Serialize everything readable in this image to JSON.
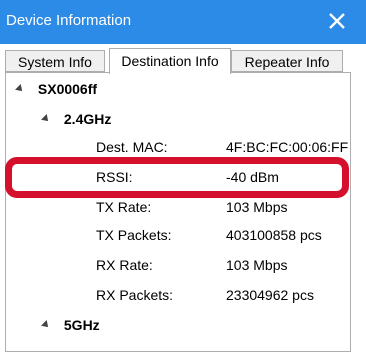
{
  "window": {
    "title": "Device Information",
    "close_label": "close"
  },
  "tabs": [
    {
      "label": "System Info"
    },
    {
      "label": "Destination Info"
    },
    {
      "label": "Repeater Info"
    }
  ],
  "tree": {
    "root": {
      "label": "SX0006ff"
    },
    "band1": {
      "label": "2.4GHz"
    },
    "band2": {
      "label": "5GHz"
    },
    "props": [
      {
        "name": "Dest. MAC:",
        "value": "4F:BC:FC:00:06:FF"
      },
      {
        "name": "RSSI:",
        "value": "-40 dBm"
      },
      {
        "name": "TX Rate:",
        "value": "103 Mbps"
      },
      {
        "name": "TX Packets:",
        "value": "403100858 pcs"
      },
      {
        "name": "RX Rate:",
        "value": "103 Mbps"
      },
      {
        "name": "RX Packets:",
        "value": "23304962 pcs"
      }
    ]
  },
  "colors": {
    "titlebar": "#2b8be6",
    "highlight": "#d4102d"
  }
}
